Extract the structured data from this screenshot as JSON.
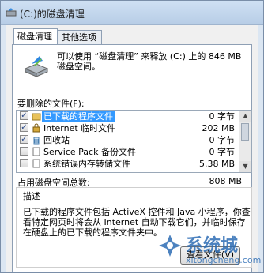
{
  "window": {
    "title": "(C:)的磁盘清理"
  },
  "tabs": [
    {
      "label": "磁盘清理"
    },
    {
      "label": "其他选项"
    }
  ],
  "intro": "可以使用 “磁盘清理” 来释放 (C:) 上的 846 MB 磁盘空间。",
  "list_label": "要删除的文件(F):",
  "files": [
    {
      "name": "已下载的程序文件",
      "size": "0 字节",
      "checked": true,
      "icon": "folder-icon"
    },
    {
      "name": "Internet 临时文件",
      "size": "202 MB",
      "checked": true,
      "icon": "lock-icon"
    },
    {
      "name": "回收站",
      "size": "0 字节",
      "checked": true,
      "icon": "recycle-bin-icon"
    },
    {
      "name": "Service Pack 备份文件",
      "size": "0 字节",
      "checked": false,
      "icon": "document-icon"
    },
    {
      "name": "系统错误内存转储文件",
      "size": "5.38 MB",
      "checked": false,
      "icon": "document-icon"
    }
  ],
  "total_label": "占用磁盘空间总数:",
  "total_value": "808 MB",
  "description": {
    "title": "描述",
    "text": "已下载的程序文件包括 ActiveX 控件和 Java 小程序，你查看特定网页时将会从 Internet 自动下载它们，并临时保存在硬盘上的已下载的程序文件夹中。"
  },
  "view_files_button": "查看文件(V)",
  "watermark": {
    "text": "系统城",
    "url": "xitongcheng.com"
  }
}
